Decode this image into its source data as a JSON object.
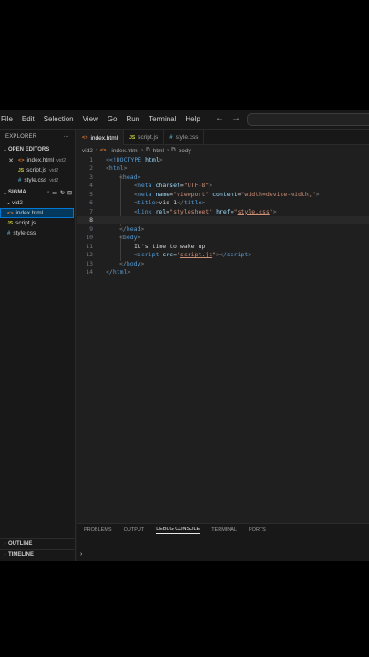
{
  "menubar": {
    "items": [
      "File",
      "Edit",
      "Selection",
      "View",
      "Go",
      "Run",
      "Terminal",
      "Help"
    ],
    "back_icon": "←",
    "forward_icon": "→"
  },
  "sidebar": {
    "title": "EXPLORER",
    "more_icon": "···",
    "open_editors_label": "OPEN EDITORS",
    "open_editors": [
      {
        "name": "index.html",
        "hint": "vid2",
        "icon": "html"
      },
      {
        "name": "script.js",
        "hint": "vid2",
        "icon": "js"
      },
      {
        "name": "style.css",
        "hint": "vid2",
        "icon": "css"
      }
    ],
    "project_label": "SIGMA ...",
    "folder": "vid2",
    "files": [
      {
        "name": "index.html",
        "icon": "html"
      },
      {
        "name": "script.js",
        "icon": "js"
      },
      {
        "name": "style.css",
        "icon": "css"
      }
    ],
    "outline_label": "OUTLINE",
    "timeline_label": "TIMELINE"
  },
  "tabs": [
    {
      "label": "index.html",
      "icon": "html",
      "active": true
    },
    {
      "label": "script.js",
      "icon": "js",
      "active": false
    },
    {
      "label": "style.css",
      "icon": "css",
      "active": false
    }
  ],
  "breadcrumb": [
    "vid2",
    "index.html",
    "html",
    "body"
  ],
  "editor": {
    "line_numbers": [
      "1",
      "2",
      "3",
      "4",
      "5",
      "6",
      "7",
      "8",
      "9",
      "10",
      "11",
      "12",
      "13",
      "14"
    ],
    "current_line": 8,
    "text": {
      "l1_doctype": "<!DOCTYPE",
      "l1_html": "html",
      "l2": "html",
      "l3": "head",
      "l4_tag": "meta",
      "l4_attr": "charset",
      "l4_val": "\"UTF-8\"",
      "l5_tag": "meta",
      "l5_attr1": "name",
      "l5_val1": "\"viewport\"",
      "l5_attr2": "content",
      "l5_val2": "\"width=device-width,\"",
      "l6_tag": "title",
      "l6_text": "vid 1",
      "l6_close": "title",
      "l7_tag": "link",
      "l7_attr1": "rel",
      "l7_val1": "\"stylesheet\"",
      "l7_attr2": "href",
      "l7_q1": "\"",
      "l7_val2": "style.css",
      "l7_q2": "\"",
      "l9": "/head",
      "l10": "body",
      "l11": "It's time to wake up",
      "l12_tag": "script",
      "l12_attr": "src",
      "l12_q1": "\"",
      "l12_val": "script.js",
      "l12_q2": "\"",
      "l12_close": "/script",
      "l13": "/body",
      "l14": "/html"
    }
  },
  "panel": {
    "tabs": [
      "PROBLEMS",
      "OUTPUT",
      "DEBUG CONSOLE",
      "TERMINAL",
      "PORTS"
    ],
    "active_tab": "DEBUG CONSOLE",
    "prompt_icon": "›"
  }
}
